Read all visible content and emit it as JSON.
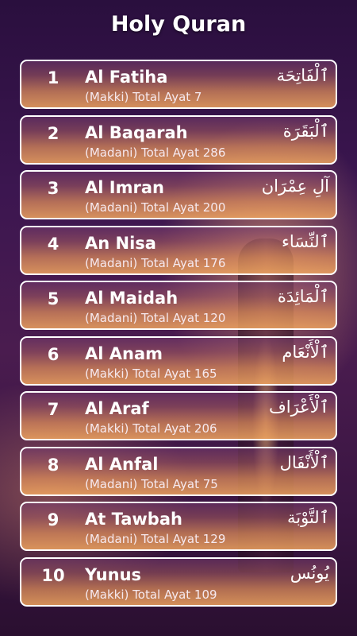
{
  "header": {
    "title": "Holy Quran"
  },
  "surahs": [
    {
      "number": "1",
      "name": "Al Fatiha",
      "info": "(Makki) Total Ayat 7",
      "arabic": "ٱلْفَاتِحَة"
    },
    {
      "number": "2",
      "name": "Al Baqarah",
      "info": "(Madani) Total Ayat 286",
      "arabic": "ٱلْبَقَرَة"
    },
    {
      "number": "3",
      "name": "Al Imran",
      "info": "(Madani) Total Ayat 200",
      "arabic": "آلِ عِمْرَان"
    },
    {
      "number": "4",
      "name": "An Nisa",
      "info": "(Madani) Total Ayat 176",
      "arabic": "ٱلنِّسَاء"
    },
    {
      "number": "5",
      "name": "Al Maidah",
      "info": "(Madani) Total Ayat 120",
      "arabic": "ٱلْمَائِدَة"
    },
    {
      "number": "6",
      "name": "Al Anam",
      "info": "(Makki) Total Ayat 165",
      "arabic": "ٱلْأَنْعَام"
    },
    {
      "number": "7",
      "name": "Al Araf",
      "info": "(Makki) Total Ayat 206",
      "arabic": "ٱلْأَعْرَاف"
    },
    {
      "number": "8",
      "name": "Al Anfal",
      "info": "(Madani) Total Ayat 75",
      "arabic": "ٱلْأَنْفَال"
    },
    {
      "number": "9",
      "name": "At Tawbah",
      "info": "(Madani) Total Ayat 129",
      "arabic": "ٱلتَّوْبَة"
    },
    {
      "number": "10",
      "name": "Yunus",
      "info": "(Makki) Total Ayat 109",
      "arabic": "يُونُس"
    }
  ]
}
